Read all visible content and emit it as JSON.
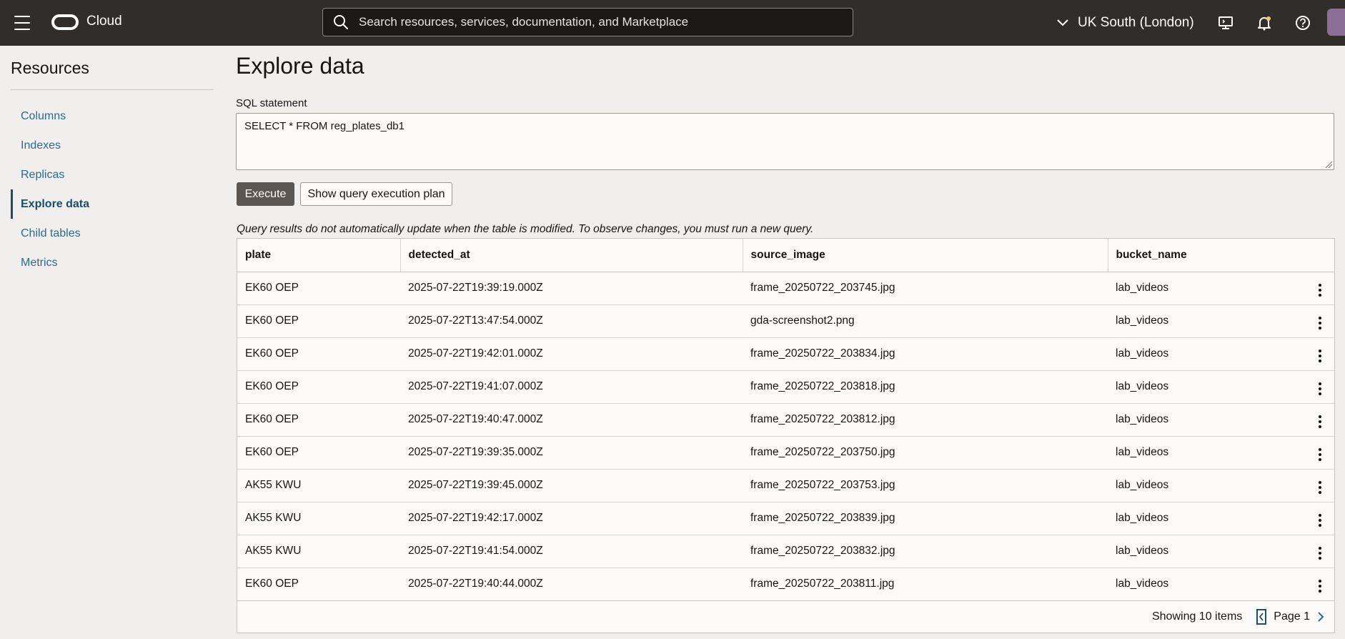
{
  "header": {
    "brand": "Cloud",
    "search_placeholder": "Search resources, services, documentation, and Marketplace",
    "region": "UK South (London)",
    "icons": [
      "menu-icon",
      "oracle-logo-icon",
      "search-icon",
      "chevron-down-icon",
      "cloud-shell-icon",
      "bell-icon",
      "help-icon",
      "user-avatar-icon"
    ]
  },
  "sidebar": {
    "title": "Resources",
    "items": [
      {
        "label": "Columns",
        "active": false
      },
      {
        "label": "Indexes",
        "active": false
      },
      {
        "label": "Replicas",
        "active": false
      },
      {
        "label": "Explore data",
        "active": true
      },
      {
        "label": "Child tables",
        "active": false
      },
      {
        "label": "Metrics",
        "active": false
      }
    ]
  },
  "main": {
    "title": "Explore data",
    "sql_label": "SQL statement",
    "sql_value": "SELECT * FROM reg_plates_db1",
    "execute_label": "Execute",
    "plan_label": "Show query execution plan",
    "note": "Query results do not automatically update when the table is modified. To observe changes, you must run a new query."
  },
  "table": {
    "columns": [
      "plate",
      "detected_at",
      "source_image",
      "bucket_name"
    ],
    "rows": [
      [
        "EK60 OEP",
        "2025-07-22T19:39:19.000Z",
        "frame_20250722_203745.jpg",
        "lab_videos"
      ],
      [
        "EK60 OEP",
        "2025-07-22T13:47:54.000Z",
        "gda-screenshot2.png",
        "lab_videos"
      ],
      [
        "EK60 OEP",
        "2025-07-22T19:42:01.000Z",
        "frame_20250722_203834.jpg",
        "lab_videos"
      ],
      [
        "EK60 OEP",
        "2025-07-22T19:41:07.000Z",
        "frame_20250722_203818.jpg",
        "lab_videos"
      ],
      [
        "EK60 OEP",
        "2025-07-22T19:40:47.000Z",
        "frame_20250722_203812.jpg",
        "lab_videos"
      ],
      [
        "EK60 OEP",
        "2025-07-22T19:39:35.000Z",
        "frame_20250722_203750.jpg",
        "lab_videos"
      ],
      [
        "AK55 KWU",
        "2025-07-22T19:39:45.000Z",
        "frame_20250722_203753.jpg",
        "lab_videos"
      ],
      [
        "AK55 KWU",
        "2025-07-22T19:42:17.000Z",
        "frame_20250722_203839.jpg",
        "lab_videos"
      ],
      [
        "AK55 KWU",
        "2025-07-22T19:41:54.000Z",
        "frame_20250722_203832.jpg",
        "lab_videos"
      ],
      [
        "EK60 OEP",
        "2025-07-22T19:40:44.000Z",
        "frame_20250722_203811.jpg",
        "lab_videos"
      ]
    ],
    "footer_count": "Showing 10 items",
    "page_label": "Page 1"
  },
  "colors": {
    "header_bg": "#312d2a",
    "page_bg": "#f1efed",
    "link": "#2b6c8f",
    "primary_button": "#5b5652"
  }
}
